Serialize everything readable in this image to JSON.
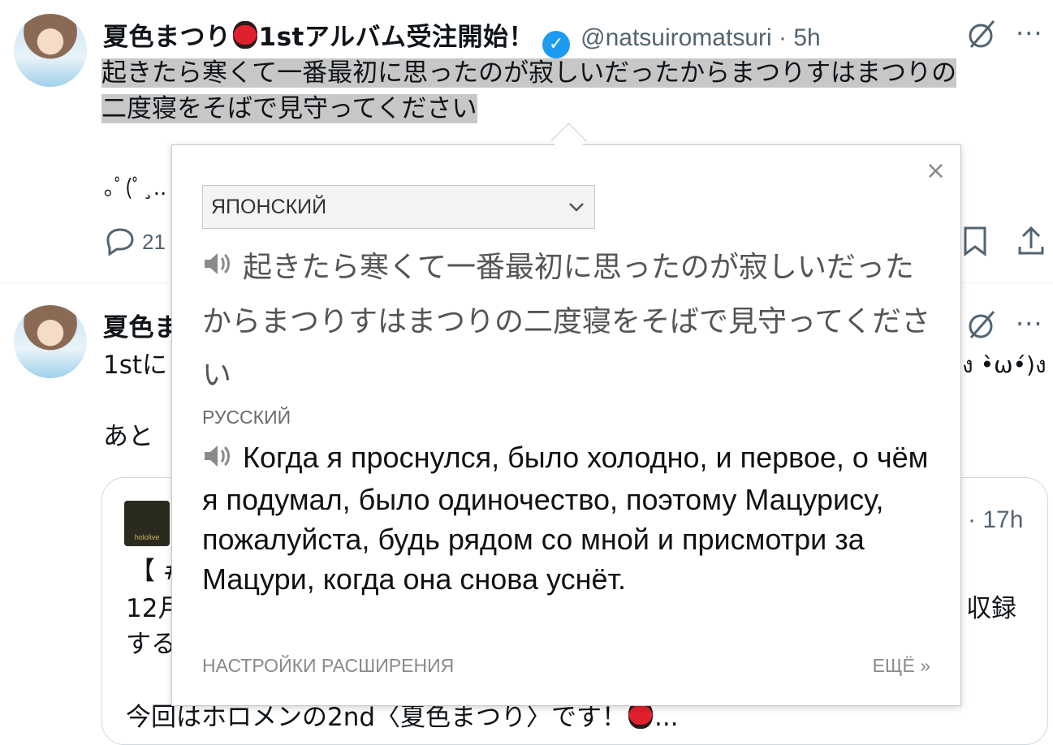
{
  "tweet1": {
    "display_name": "夏色まつり",
    "name_suffix": "1stアルバム受注開始！",
    "handle": "@natsuiromatsuri · 5h",
    "text_line1": "起きたら寒くて一番最初に思ったのが寂しいだったからまつりすはまつりの",
    "text_line2": "二度寝をそばで見守ってください",
    "emoticon_partial": "｡ﾟ(ﾟ¸..",
    "reply_count_partial": "21"
  },
  "tweet2": {
    "display_name_partial": "夏色ま",
    "text_partial_left": "1stに",
    "text_partial_right": "ง •̀ω•́)ง",
    "line2_partial": "あと"
  },
  "quote": {
    "time_partial": "· 17h",
    "logo_text": "hololive",
    "line1_partial": "【 #",
    "line2_partial_left": "12月",
    "line2_partial_right": "収録",
    "line3_partial": "する",
    "line4": "今回はホロメンの2nd〈夏色まつり〉です！",
    "ellipsis": "..."
  },
  "popup": {
    "close": "×",
    "source_language": "ЯПОНСКИЙ",
    "source_text": "起きたら寒くて一番最初に思ったのが寂しいだったからまつりすはまつりの二度寝をそばで見守ってください",
    "target_label": "РУССКИЙ",
    "target_text": "Когда я проснулся, было холодно, и первое, о чём я подумал, было одиночество, поэтому Мацурису, пожалуйста, будь рядом со мной и присмотри за Мацури, когда она снова уснёт.",
    "settings_link": "НАСТРОЙКИ РАСШИРЕНИЯ",
    "more_link": "ЕЩЁ »"
  },
  "icons": {
    "verified_color": "#1d9bf0",
    "lantern_color": "#e0202e"
  }
}
